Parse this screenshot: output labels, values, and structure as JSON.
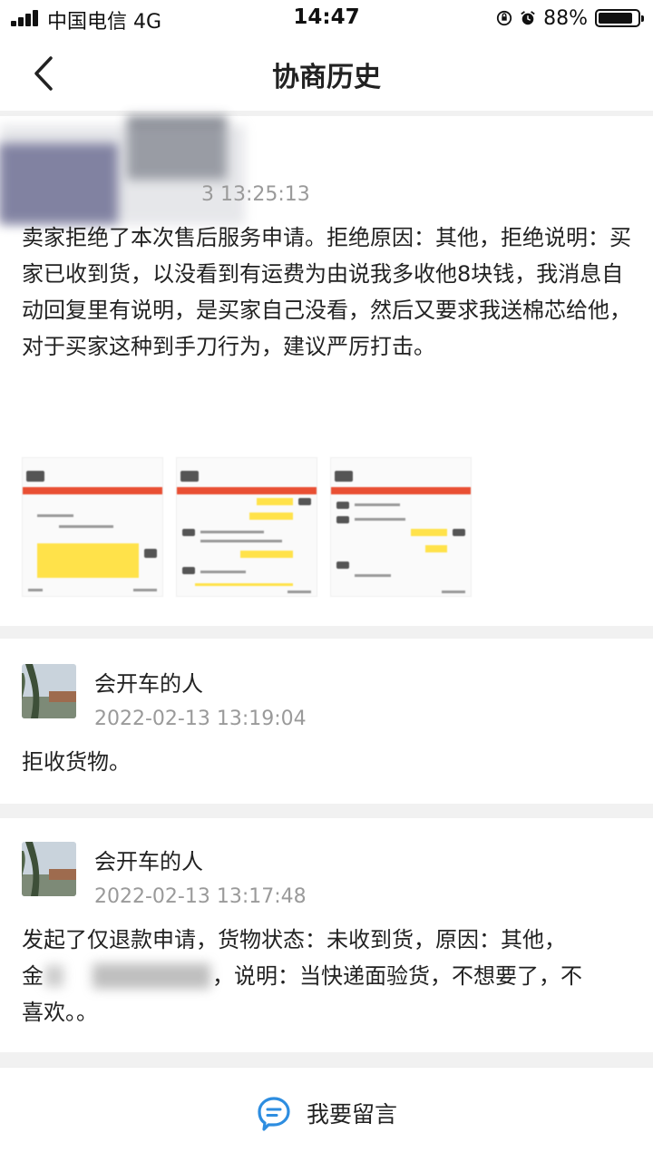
{
  "status_bar": {
    "carrier": "中国电信  4G",
    "time": "14:47",
    "battery_pct": "88%",
    "battery_level": 0.88
  },
  "nav": {
    "title": "协商历史"
  },
  "entries": [
    {
      "timestamp": "3 13:25:13",
      "text": "卖家拒绝了本次售后服务申请。拒绝原因：其他，拒绝说明：买家已收到货，以没看到有运费为由说我多收他8块钱，我消息自动回复里有说明，是买家自己没看，然后又要求我送棉芯给他，对于买家这种到手刀行为，建议严厉打击。"
    },
    {
      "user": "会开车的人",
      "timestamp": "2022-02-13 13:19:04",
      "text": "拒收货物。"
    },
    {
      "user": "会开车的人",
      "timestamp": "2022-02-13 13:17:48",
      "text_line1": "发起了仅退款申请，货物状态：未收到货，原因：其他，",
      "text_prefix": "金",
      "text_line2_after": "，说明：当快递面验货，不想要了，不",
      "text_line3": "喜欢。。"
    }
  ],
  "comment_button": {
    "label": "我要留言"
  },
  "icons": {
    "back": "chevron-left-icon",
    "comment": "chat-bubble-icon",
    "lock": "orientation-lock-icon",
    "alarm": "alarm-icon"
  },
  "colors": {
    "accent": "#2d8de0",
    "timestamp": "#9a9a9a",
    "separator": "#f1f1f1"
  }
}
